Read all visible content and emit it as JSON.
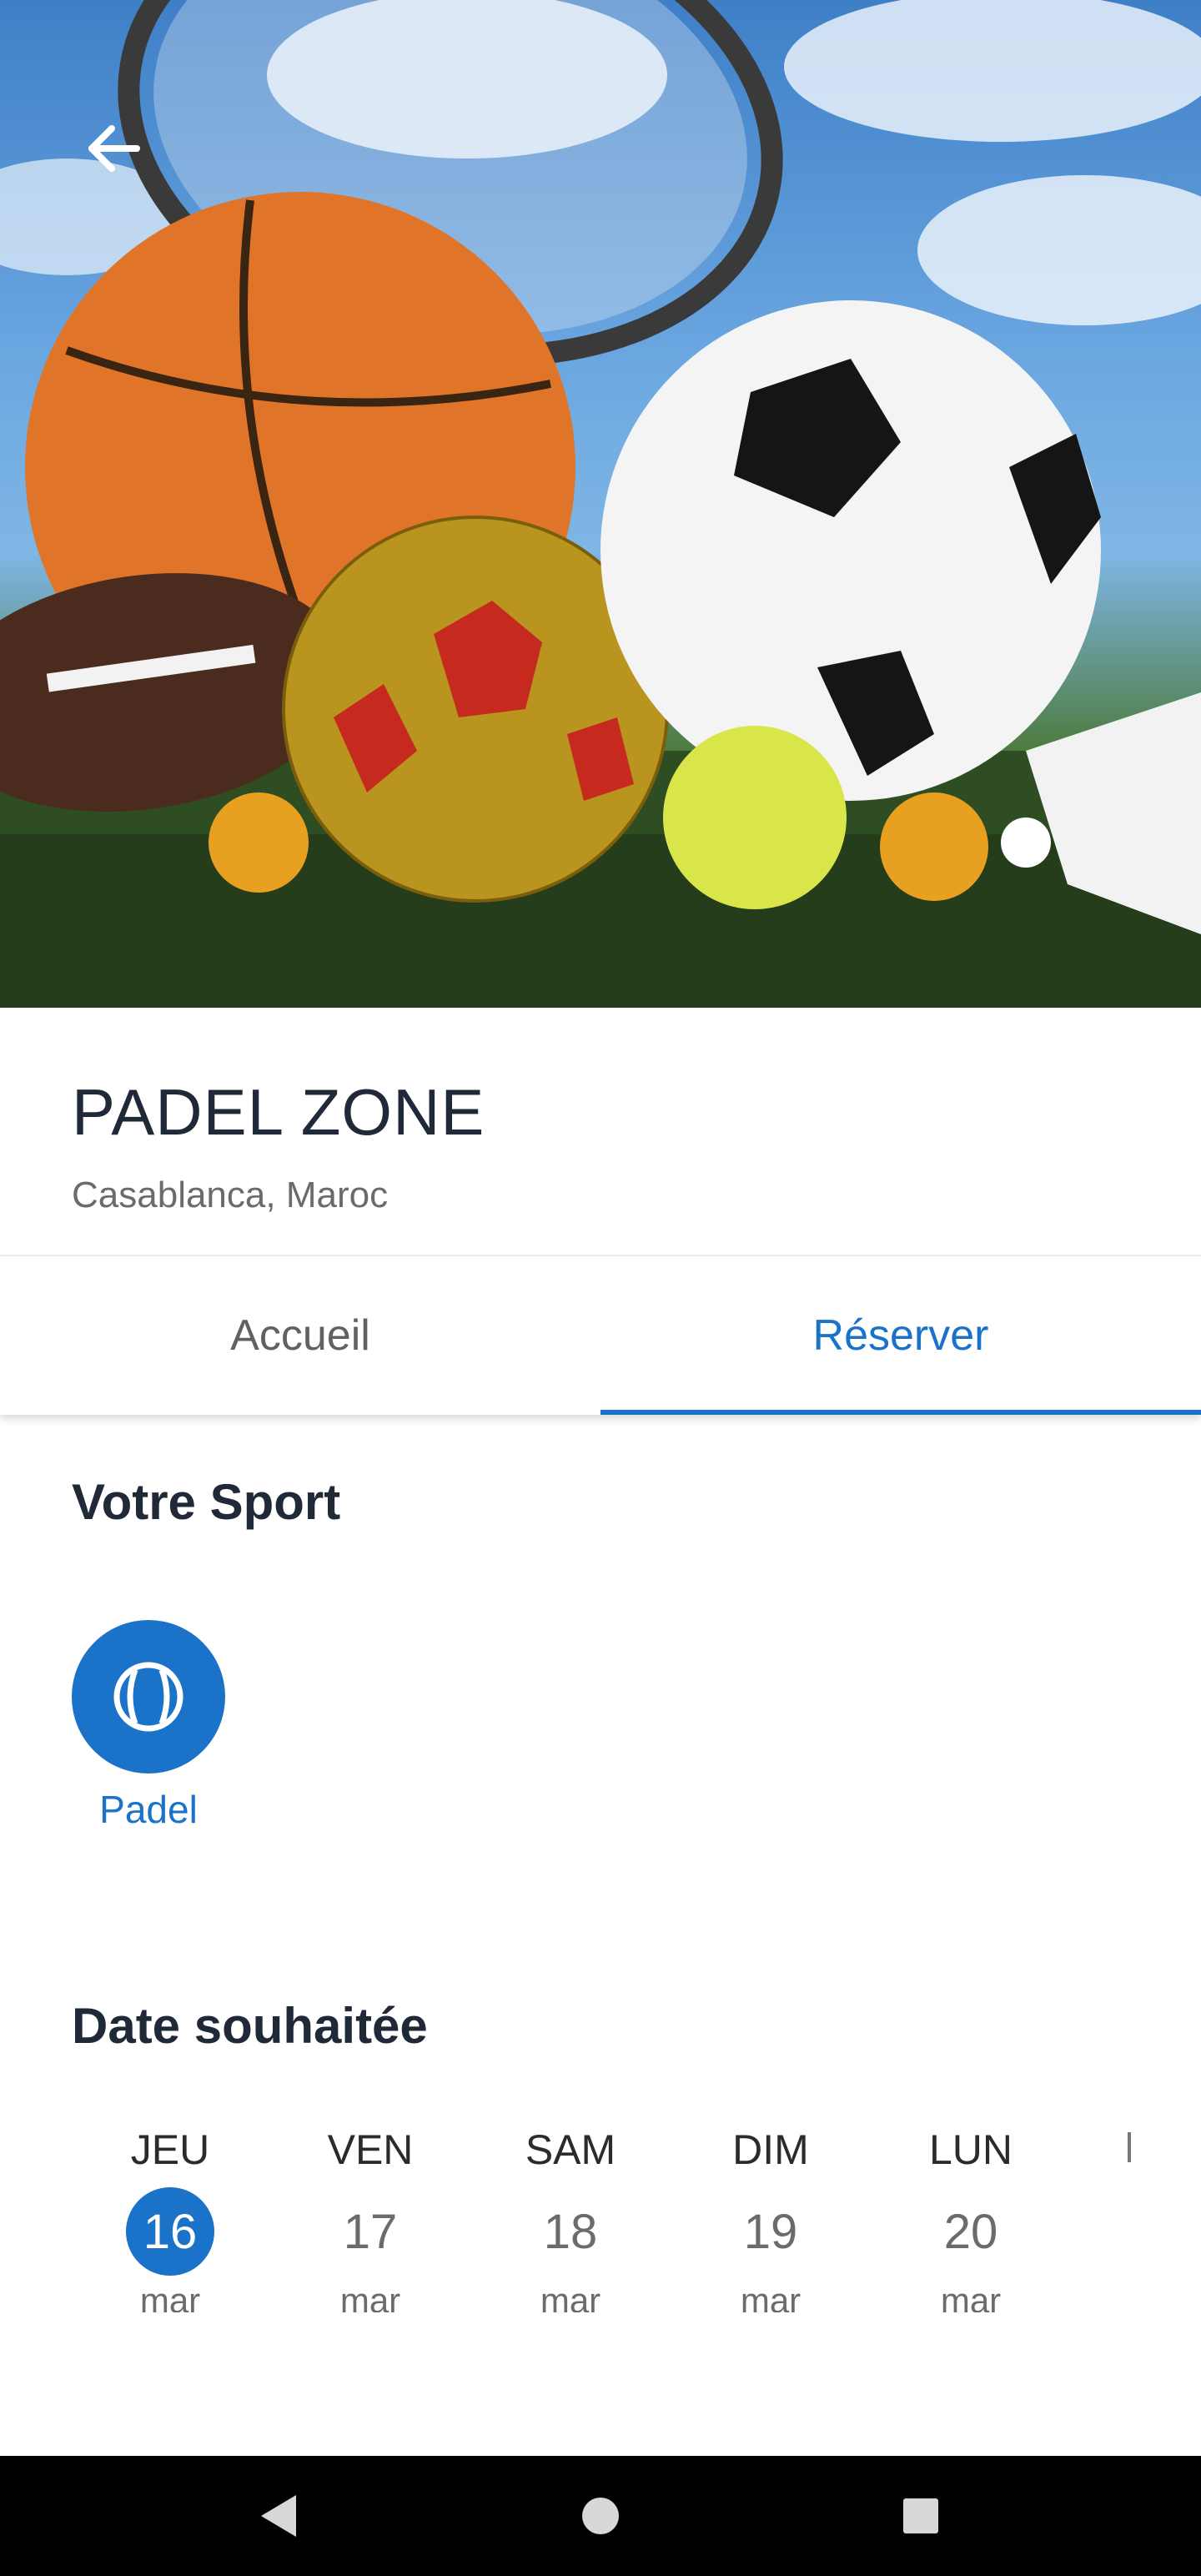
{
  "venue": {
    "name": "PADEL ZONE",
    "location": "Casablanca, Maroc"
  },
  "tabs": [
    {
      "label": "Accueil",
      "active": false
    },
    {
      "label": "Réserver",
      "active": true
    }
  ],
  "sport_section": {
    "title": "Votre Sport",
    "sports": [
      {
        "label": "Padel",
        "icon": "ball-icon",
        "selected": true
      }
    ]
  },
  "date_section": {
    "title": "Date souhaitée",
    "dates": [
      {
        "day": "JEU",
        "num": "16",
        "month": "mar",
        "selected": true
      },
      {
        "day": "VEN",
        "num": "17",
        "month": "mar",
        "selected": false
      },
      {
        "day": "SAM",
        "num": "18",
        "month": "mar",
        "selected": false
      },
      {
        "day": "DIM",
        "num": "19",
        "month": "mar",
        "selected": false
      },
      {
        "day": "LUN",
        "num": "20",
        "month": "mar",
        "selected": false
      }
    ]
  },
  "colors": {
    "accent": "#1a73c9",
    "title_text": "#1f2937",
    "secondary_text": "#6b6b6b",
    "navbar": "#000000"
  }
}
